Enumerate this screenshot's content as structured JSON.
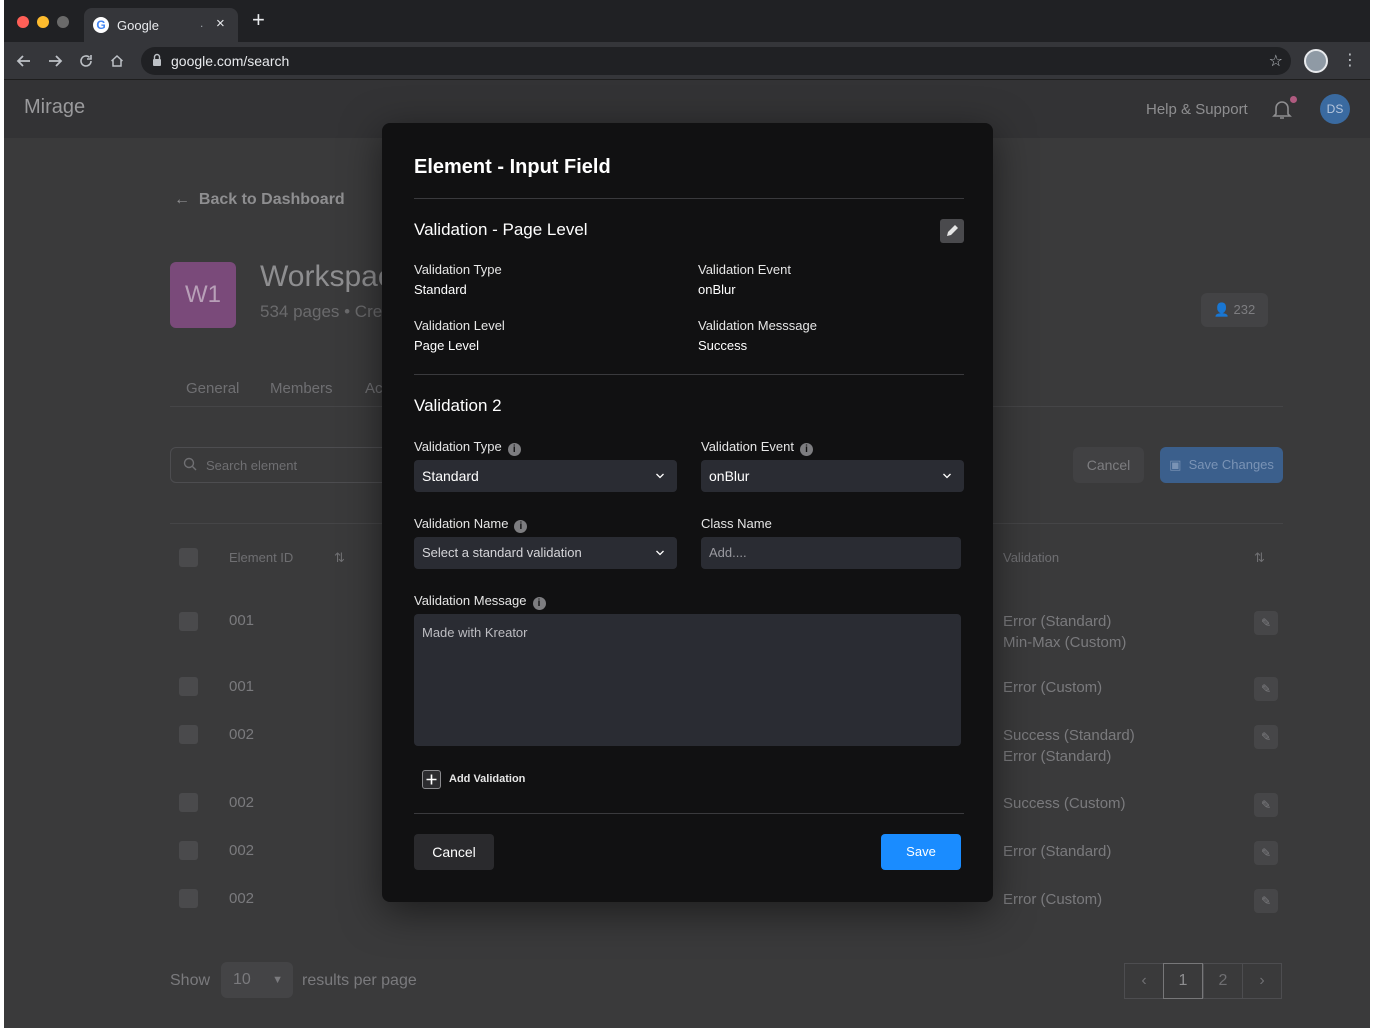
{
  "browser": {
    "tab_title": "Google",
    "tab_dot": ".",
    "tab_close": "×",
    "new_tab": "+",
    "url": "google.com/search"
  },
  "app": {
    "brand": "Mirage",
    "help": "Help & Support",
    "user_initials": "DS",
    "back_link": "Back to Dashboard",
    "workspace_badge": "W1",
    "workspace_title": "Workspac",
    "workspace_sub": "534 pages • Cre",
    "member_count": "232",
    "tabs": [
      "General",
      "Members",
      "Ac"
    ],
    "search_placeholder": "Search element",
    "cancel": "Cancel",
    "save_changes": "Save Changes",
    "columns": {
      "element_id": "Element ID",
      "validation": "Validation"
    },
    "rows": [
      {
        "id": "001",
        "validation": [
          "Error (Standard)",
          "Min-Max (Custom)"
        ]
      },
      {
        "id": "001",
        "validation": [
          "Error (Custom)"
        ]
      },
      {
        "id": "002",
        "validation": [
          "Success (Standard)",
          "Error (Standard)"
        ]
      },
      {
        "id": "002",
        "validation": [
          "Success (Custom)"
        ]
      },
      {
        "id": "002",
        "validation": [
          "Error (Standard)"
        ]
      },
      {
        "id": "002",
        "validation": [
          "Error (Custom)"
        ]
      }
    ],
    "show_label": "Show",
    "per_page": "10",
    "results_label": "results per page",
    "pages": [
      "‹",
      "1",
      "2",
      "›"
    ],
    "active_page": "1"
  },
  "modal": {
    "title": "Element - Input Field",
    "section1": {
      "title": "Validation - Page Level",
      "type_label": "Validation Type",
      "type_value": "Standard",
      "event_label": "Validation Event",
      "event_value": "onBlur",
      "level_label": "Validation Level",
      "level_value": "Page Level",
      "message_label": "Validation Messsage",
      "message_value": "Success"
    },
    "section2": {
      "title": "Validation 2",
      "type_label": "Validation Type",
      "type_value": "Standard",
      "event_label": "Validation Event",
      "event_value": "onBlur",
      "name_label": "Validation Name",
      "name_value": "Select a standard validation",
      "class_label": "Class Name",
      "class_placeholder": "Add....",
      "message_label": "Validation Message",
      "message_value": "Made with Kreator"
    },
    "add_validation": "Add Validation",
    "cancel": "Cancel",
    "save": "Save"
  }
}
